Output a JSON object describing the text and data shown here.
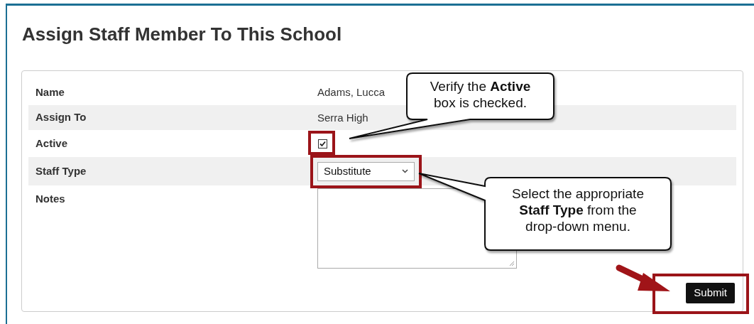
{
  "title": "Assign Staff Member To This School",
  "fields": [
    {
      "kind": "text",
      "label": "Name",
      "value": "Adams, Lucca"
    },
    {
      "kind": "text",
      "label": "Assign To",
      "value": "Serra High"
    },
    {
      "kind": "checkbox",
      "label": "Active",
      "checked": true,
      "highlighted": true
    },
    {
      "kind": "select",
      "label": "Staff Type",
      "value": "Substitute",
      "highlighted": true
    },
    {
      "kind": "textarea",
      "label": "Notes"
    }
  ],
  "submit": {
    "label": "Submit",
    "highlighted": true
  },
  "callouts": [
    {
      "text": "Verify the **Active** box is checked."
    },
    {
      "text": "Select the appropriate **Staff Type** from the drop-down menu."
    }
  ]
}
